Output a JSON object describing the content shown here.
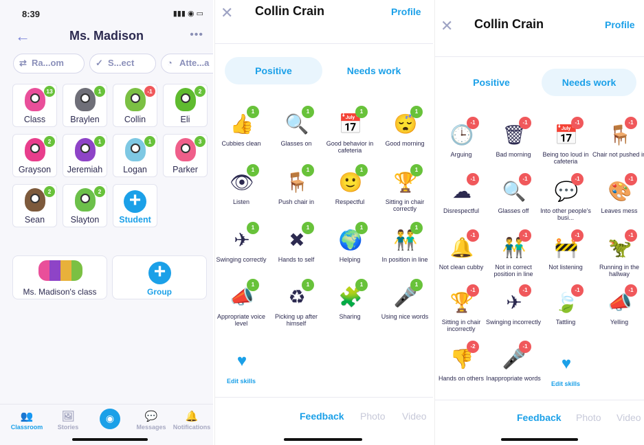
{
  "classroom": {
    "status": {
      "time": "8:39",
      "icons": "▮▮▮ ◉ ▭"
    },
    "title": "Ms. Madison",
    "more": "•••",
    "back_icon": "←",
    "actions": [
      {
        "label": "Ra...om",
        "icon": "⇄"
      },
      {
        "label": "S...ect",
        "icon": "✓"
      },
      {
        "label": "Atte...a",
        "icon": "◔"
      }
    ],
    "students": [
      {
        "name": "Class",
        "badge": "13",
        "type": "pos",
        "color": "#e94f9a"
      },
      {
        "name": "Braylen",
        "badge": "1",
        "type": "pos",
        "color": "#6f6f78"
      },
      {
        "name": "Collin",
        "badge": "-1",
        "type": "neg",
        "color": "#7bc043"
      },
      {
        "name": "Eli",
        "badge": "2",
        "type": "pos",
        "color": "#5fbb2f"
      },
      {
        "name": "Grayson",
        "badge": "2",
        "type": "pos",
        "color": "#e83e8c"
      },
      {
        "name": "Jeremiah",
        "badge": "1",
        "type": "pos",
        "color": "#8e44c7"
      },
      {
        "name": "Logan",
        "badge": "1",
        "type": "pos",
        "color": "#7ec8e3"
      },
      {
        "name": "Parker",
        "badge": "3",
        "type": "pos",
        "color": "#ef5f8a"
      },
      {
        "name": "Sean",
        "badge": "2",
        "type": "pos",
        "color": "#7d5a3c"
      },
      {
        "name": "Slayton",
        "badge": "2",
        "type": "pos",
        "color": "#6cc04a"
      }
    ],
    "add_student": "Student",
    "class_card": "Ms. Madison's class",
    "group_card": "Group",
    "tabs": [
      {
        "label": "Classroom",
        "icon": "👥"
      },
      {
        "label": "Stories",
        "icon": "🖼"
      },
      {
        "label": "Messages",
        "icon": "💬"
      },
      {
        "label": "Notifications",
        "icon": "🔔"
      }
    ],
    "camera_icon": "◉"
  },
  "positive": {
    "title": "Collin Crain",
    "profile": "Profile",
    "close": "✕",
    "seg_positive": "Positive",
    "seg_needs": "Needs work",
    "skills": [
      {
        "label": "Cubbies clean",
        "icon": "👍",
        "badge": "1"
      },
      {
        "label": "Glasses on",
        "icon": "🔍",
        "badge": "1"
      },
      {
        "label": "Good behavior in cafeteria",
        "icon": "📅",
        "badge": "1"
      },
      {
        "label": "Good morning",
        "icon": "😴",
        "badge": "1"
      },
      {
        "label": "Listen",
        "icon": "👁",
        "badge": "1"
      },
      {
        "label": "Push chair in",
        "icon": "🪑",
        "badge": "1"
      },
      {
        "label": "Respectful",
        "icon": "🙂",
        "badge": "1"
      },
      {
        "label": "Sitting in chair correctly",
        "icon": "🏆",
        "badge": "1"
      },
      {
        "label": "Swinging correctly",
        "icon": "✈",
        "badge": "1"
      },
      {
        "label": "Hands to self",
        "icon": "✖",
        "badge": "1"
      },
      {
        "label": "Helping",
        "icon": "🌍",
        "badge": "1"
      },
      {
        "label": "In position in line",
        "icon": "👬",
        "badge": "1"
      },
      {
        "label": "Appropriate voice level",
        "icon": "📣",
        "badge": "1"
      },
      {
        "label": "Picking up after himself",
        "icon": "♻",
        "badge": "1"
      },
      {
        "label": "Sharing",
        "icon": "🧩",
        "badge": "1"
      },
      {
        "label": "Using nice words",
        "icon": "🎤",
        "badge": "1"
      }
    ],
    "edit": "Edit skills",
    "footer": [
      "Feedback",
      "Photo",
      "Video"
    ]
  },
  "needs": {
    "title": "Collin Crain",
    "profile": "Profile",
    "close": "✕",
    "seg_positive": "Positive",
    "seg_needs": "Needs work",
    "skills": [
      {
        "label": "Arguing",
        "icon": "🕒",
        "badge": "-1"
      },
      {
        "label": "Bad morning",
        "icon": "🗑",
        "badge": "-1"
      },
      {
        "label": "Being too loud in cafeteria",
        "icon": "📅",
        "badge": "-1"
      },
      {
        "label": "Chair not pushed in",
        "icon": "🪑",
        "badge": "-1"
      },
      {
        "label": "Disrespectful",
        "icon": "☁",
        "badge": "-1"
      },
      {
        "label": "Glasses off",
        "icon": "🔍",
        "badge": "-1"
      },
      {
        "label": "Into other people's busi...",
        "icon": "💬",
        "badge": "-1"
      },
      {
        "label": "Leaves mess",
        "icon": "🎨",
        "badge": "-1"
      },
      {
        "label": "Not clean cubby",
        "icon": "🔔",
        "badge": "-1"
      },
      {
        "label": "Not in correct position in line",
        "icon": "👬",
        "badge": "-1"
      },
      {
        "label": "Not listening",
        "icon": "🚧",
        "badge": "-1"
      },
      {
        "label": "Running in the hallway",
        "icon": "🦖",
        "badge": "-1"
      },
      {
        "label": "Sitting in chair incorrectly",
        "icon": "🏆",
        "badge": "-1"
      },
      {
        "label": "Swinging incorrectly",
        "icon": "✈",
        "badge": "-1"
      },
      {
        "label": "Tattling",
        "icon": "🍃",
        "badge": "-1"
      },
      {
        "label": "Yelling",
        "icon": "📣",
        "badge": "-1"
      },
      {
        "label": "Hands on others",
        "icon": "👎",
        "badge": "-2"
      },
      {
        "label": "Inappropriate words",
        "icon": "🎤",
        "badge": "-1"
      }
    ],
    "edit": "Edit skills",
    "footer": [
      "Feedback",
      "Photo",
      "Video"
    ]
  }
}
